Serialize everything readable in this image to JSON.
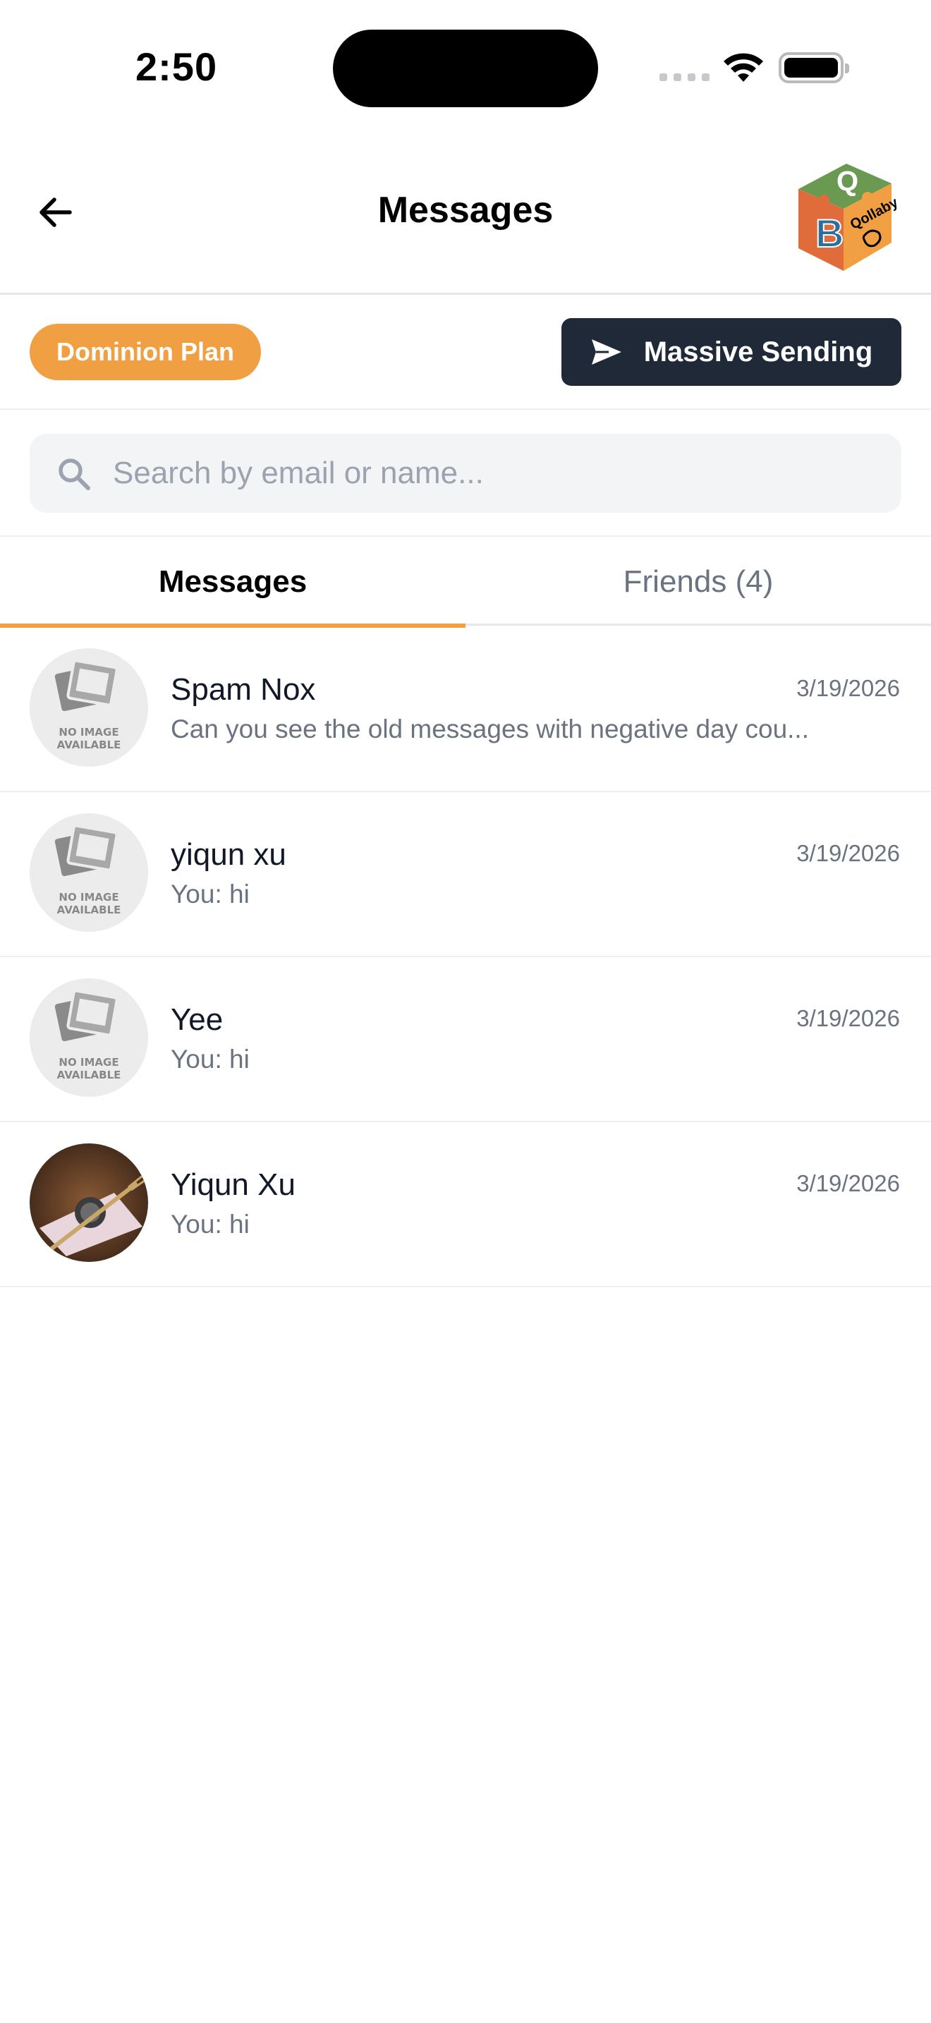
{
  "status_bar": {
    "time": "2:50"
  },
  "header": {
    "title": "Messages",
    "logo_text": "Qollaby",
    "logo_letters": [
      "B",
      "Q"
    ]
  },
  "actions": {
    "plan_label": "Dominion Plan",
    "massive_sending_label": "Massive Sending"
  },
  "search": {
    "placeholder": "Search by email or name...",
    "value": ""
  },
  "tabs": [
    {
      "label": "Messages",
      "active": true
    },
    {
      "label": "Friends (4)",
      "active": false
    }
  ],
  "avatar_placeholder": {
    "line1": "NO IMAGE",
    "line2": "AVAILABLE"
  },
  "conversations": [
    {
      "name": "Spam Nox",
      "date": "3/19/2026",
      "preview": "Can you see the old messages with negative day cou...",
      "avatar": "no-image"
    },
    {
      "name": "yiqun xu",
      "date": "3/19/2026",
      "preview": "You: hi",
      "avatar": "no-image"
    },
    {
      "name": "Yee",
      "date": "3/19/2026",
      "preview": "You: hi",
      "avatar": "no-image"
    },
    {
      "name": "Yiqun Xu",
      "date": "3/19/2026",
      "preview": "You: hi",
      "avatar": "photo"
    }
  ],
  "colors": {
    "accent": "#f0a042",
    "dark_button": "#1f2937",
    "muted_text": "#6b7280"
  }
}
